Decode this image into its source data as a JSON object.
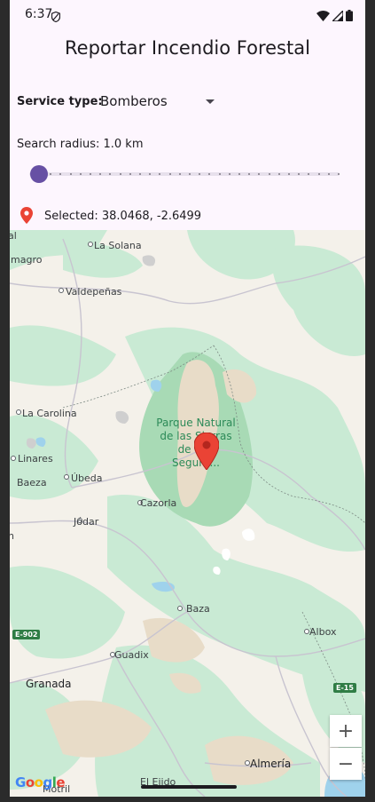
{
  "status_bar": {
    "time": "6:37",
    "icons": [
      "shield-icon",
      "wifi-icon",
      "signal-icon",
      "battery-icon"
    ]
  },
  "app": {
    "title": "Reportar Incendio Forestal"
  },
  "form": {
    "service_label": "Service type:",
    "service_value": "Bomberos",
    "radius_label": "Search radius: 1.0 km",
    "radius_slider": {
      "value_km": 1.0,
      "fraction": 0.0
    },
    "selected_label": "Selected: 38.0468, -2.6499"
  },
  "map": {
    "labels": {
      "la_solana": "La Solana",
      "almagro": "lmagro",
      "valdepenas": "Valdepeñas",
      "la_carolina": "La Carolina",
      "linares": "Linares",
      "baeza": "Baeza",
      "ubeda": "Úbeda",
      "park": "Parque Natural de las Sierras de Cazorla, Segura...",
      "park_line1": "Parque Natural",
      "park_line2": "de las Sierras",
      "park_line3": "de Caz",
      "park_line4": "Segura...",
      "cazorla": "Cazorla",
      "jodar": "Jódar",
      "baza": "Baza",
      "guadix": "Guadix",
      "granada": "Granada",
      "albox": "Albox",
      "almeria": "Almería",
      "el_ejido": "El Ejido",
      "motril": "Motril",
      "edge_left_top": "al",
      "edge_left_mid": "n"
    },
    "road_shields": {
      "e902": "E-902",
      "e15": "E-15"
    },
    "zoom_in": "+",
    "zoom_out": "−",
    "attribution": "Google",
    "colors": {
      "land": "#f4f1ea",
      "forest": "#c5e8d1",
      "park": "#a8dab5",
      "mountain": "#e8dcc8",
      "water": "#9fd2ec",
      "marker": "#ea4335"
    }
  }
}
